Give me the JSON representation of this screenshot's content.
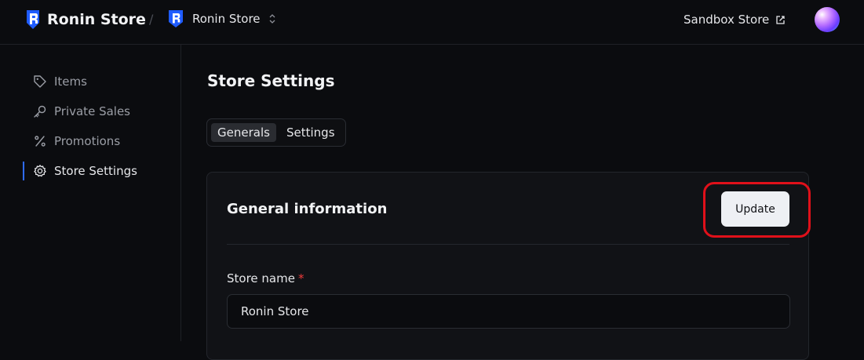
{
  "header": {
    "brand_name": "Ronin Store",
    "breadcrumb_separator": "/",
    "current_store": "Ronin Store",
    "sandbox_label": "Sandbox Store"
  },
  "sidebar": {
    "items": [
      {
        "label": "Items",
        "icon": "tag-icon"
      },
      {
        "label": "Private Sales",
        "icon": "key-icon"
      },
      {
        "label": "Promotions",
        "icon": "percent-icon"
      },
      {
        "label": "Store Settings",
        "icon": "gear-icon",
        "active": true
      }
    ]
  },
  "main": {
    "page_title": "Store Settings",
    "tabs": [
      {
        "label": "Generals",
        "selected": true
      },
      {
        "label": "Settings",
        "selected": false
      }
    ],
    "card": {
      "title": "General information",
      "update_label": "Update",
      "store_name_label": "Store name",
      "required_mark": "*",
      "store_name_value": "Ronin Store"
    }
  },
  "colors": {
    "background": "#0b0c0f",
    "accent": "#2f6bff",
    "highlight": "#e0101a",
    "required": "#ef3b3b"
  }
}
